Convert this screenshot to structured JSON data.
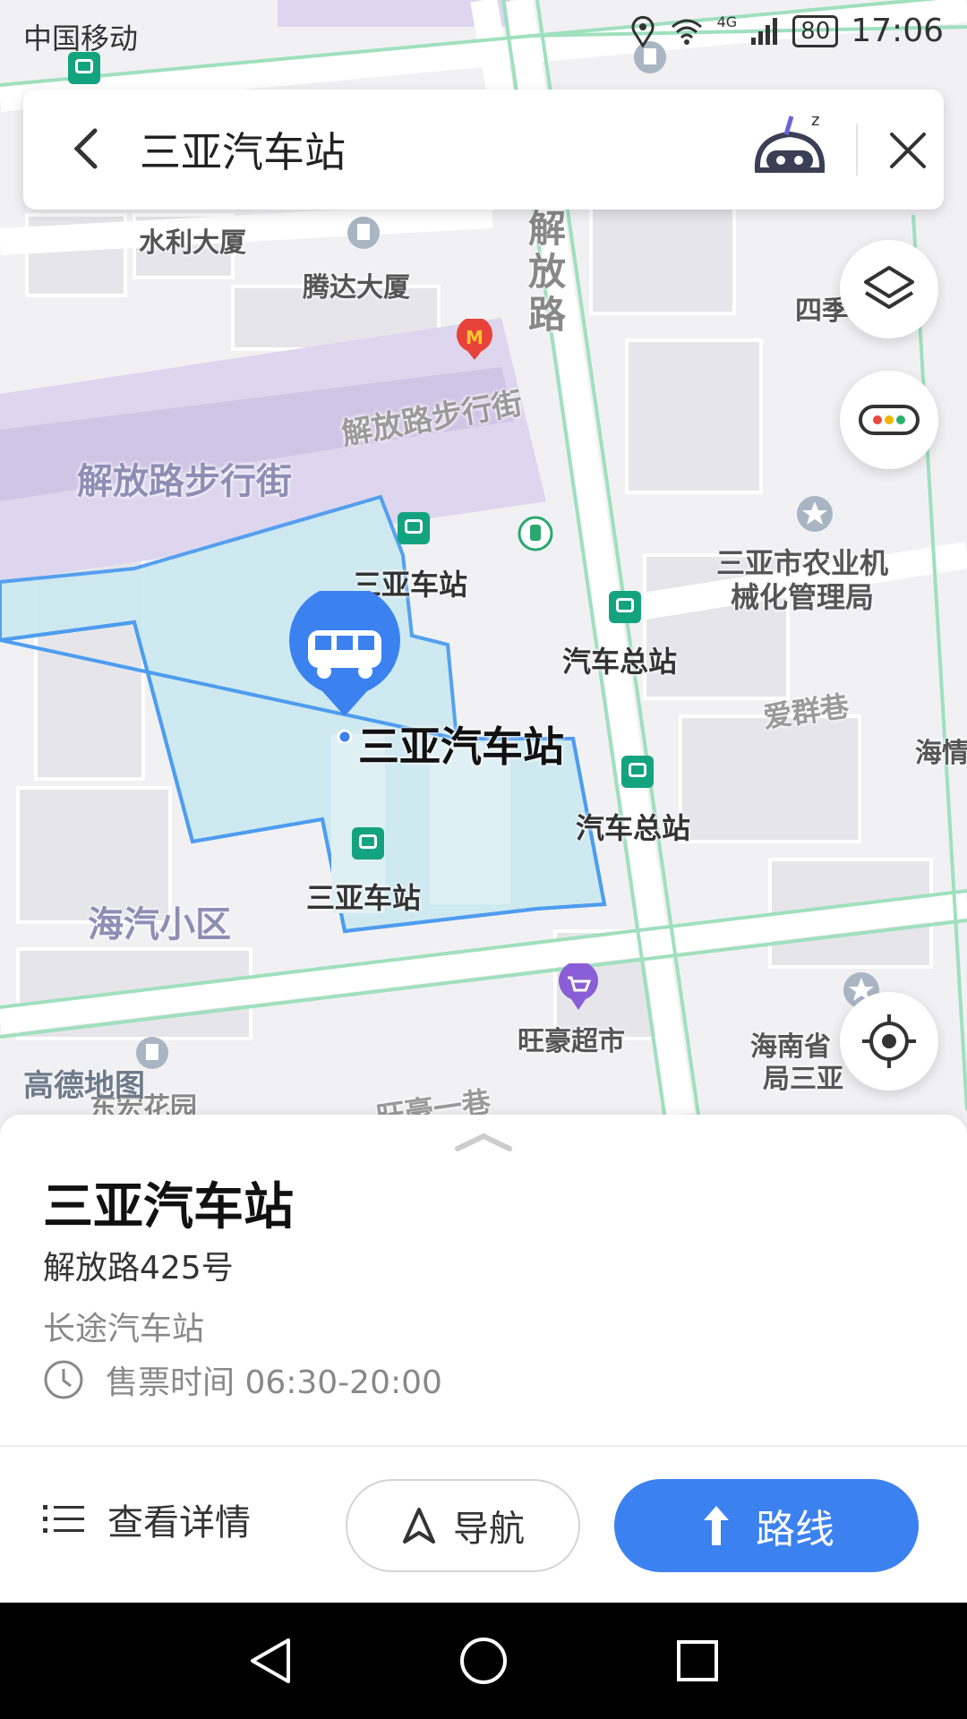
{
  "status_bar": {
    "carrier": "中国移动",
    "network": "4G",
    "battery": "80",
    "time": "17:06"
  },
  "search": {
    "query": "三亚汽车站"
  },
  "map": {
    "labels": {
      "shuili": "水利大厦",
      "tengda": "腾达大厦",
      "jiefang_road": "解放路",
      "pedestrian_street": "解放路步行街",
      "pedestrian_area": "解放路步行街",
      "sanya_station_1": "三亚车站",
      "sanya_station_2": "三亚车站",
      "bus_terminal_1": "汽车总站",
      "bus_terminal_2": "汽车总站",
      "main_poi": "三亚汽车站",
      "agri_bureau": "三亚市农业机\n械化管理局",
      "aiqun": "爱群巷",
      "haiqi": "海汽小区",
      "wanghao_market": "旺豪超市",
      "hainan_bureau": "海南省",
      "hainan_bureau_2": "局三亚",
      "dongfang": "东宏花园",
      "wanghao_lane": "旺豪一巷",
      "siji": "四季",
      "edge_right": "海情"
    },
    "watermark": "高德地图"
  },
  "place": {
    "name": "三亚汽车站",
    "address": "解放路425号",
    "category": "长途汽车站",
    "hours_label": "售票时间 06:30-20:00"
  },
  "actions": {
    "details": "查看详情",
    "navigate": "导航",
    "route": "路线"
  },
  "colors": {
    "accent": "#3b82f0",
    "bus_stop": "#13a47f",
    "highlight_fill": "#cde9f0"
  }
}
